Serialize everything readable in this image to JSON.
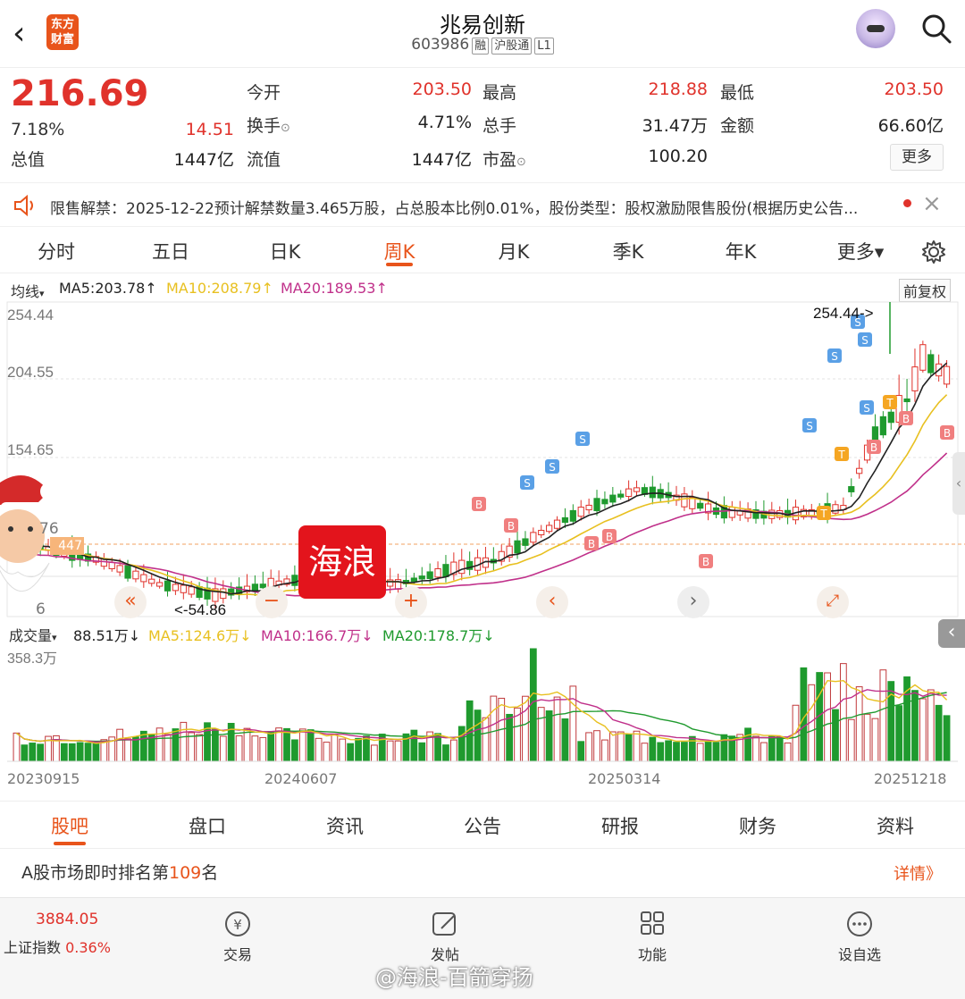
{
  "header": {
    "app_logo_text": "东方财富",
    "stock_name": "兆易创新",
    "stock_code": "603986",
    "tags": [
      "融",
      "沪股通",
      "L1"
    ]
  },
  "quote": {
    "price": "216.69",
    "change_pct": "7.18%",
    "change_amt": "14.51",
    "total_value_label": "总值",
    "total_value": "1447亿",
    "rows": [
      [
        {
          "label": "今开",
          "value": "203.50",
          "color": "red"
        },
        {
          "label": "最高",
          "value": "218.88",
          "color": "red"
        },
        {
          "label": "最低",
          "value": "203.50",
          "color": "red"
        }
      ],
      [
        {
          "label": "换手",
          "value": "4.71%",
          "color": "dark"
        },
        {
          "label": "总手",
          "value": "31.47万",
          "color": "dark"
        },
        {
          "label": "金额",
          "value": "66.60亿",
          "color": "dark"
        }
      ],
      [
        {
          "label": "流值",
          "value": "1447亿",
          "color": "dark"
        },
        {
          "label": "市盈",
          "value": "100.20",
          "color": "dark"
        }
      ]
    ],
    "more_label": "更多"
  },
  "notice": {
    "text": "限售解禁：2025-12-22预计解禁数量3.465万股，占总股本比例0.01%，股份类型：股权激励限售股份(根据历史公告..."
  },
  "period_tabs": [
    "分时",
    "五日",
    "日K",
    "周K",
    "月K",
    "季K",
    "年K",
    "更多▾"
  ],
  "active_period": "周K",
  "ma_legend": {
    "label": "均线",
    "ma5": "MA5:203.78↑",
    "ma10": "MA10:208.79↑",
    "ma20": "MA20:189.53↑",
    "fq": "前复权",
    "colors": {
      "ma5": "#222222",
      "ma10": "#e8c020",
      "ma20": "#c0308a"
    }
  },
  "price_axis": [
    "254.44",
    "204.55",
    "154.65",
    "76",
    "447",
    "6"
  ],
  "annotations": {
    "high_label": "254.44->",
    "low_label": "<-54.86",
    "overlay_text": "海浪"
  },
  "volume_legend": {
    "label": "成交量",
    "value": "88.51万↓",
    "ma5": "MA5:124.6万↓",
    "ma10": "MA10:166.7万↓",
    "ma20": "MA20:178.7万↓",
    "axis_max": "358.3万"
  },
  "date_axis": [
    "20230915",
    "20240607",
    "20250314",
    "20251218"
  ],
  "bottom_tabs": [
    "股吧",
    "盘口",
    "资讯",
    "公告",
    "研报",
    "财务",
    "资料"
  ],
  "active_bottom_tab": "股吧",
  "rank": {
    "prefix": "A股市场即时排名第",
    "number": "109",
    "suffix": "名",
    "detail": "详情》"
  },
  "footer": {
    "index_value": "3884.05",
    "index_name": "上证指数",
    "index_change": "0.36%",
    "items": [
      "交易",
      "发帖",
      "功能",
      "设自选"
    ]
  },
  "watermark": "@海浪-百箭穿扬"
}
